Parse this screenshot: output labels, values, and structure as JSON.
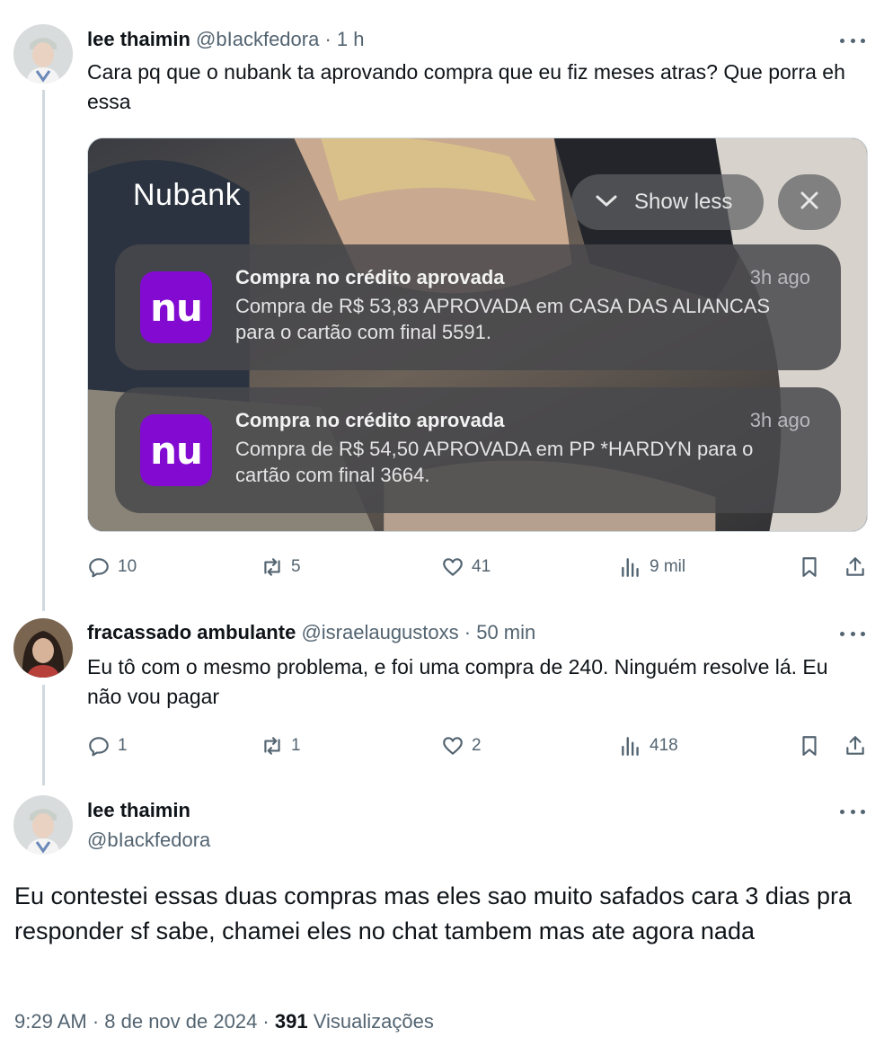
{
  "tweet1": {
    "name": "lee thaimin",
    "handle": "@bIackfedora",
    "dot": "·",
    "time": "1 h",
    "text": "Cara pq que o nubank ta aprovando compra que eu fiz meses atras? Que porra eh essa",
    "media": {
      "app_title": "Nubank",
      "show_less_label": "Show less",
      "notifications": [
        {
          "title": "Compra no crédito aprovada",
          "time": "3h ago",
          "logo_text": "nu",
          "body": "Compra de R$ 53,83 APROVADA em CASA DAS ALIANCAS para o cartão com final 5591."
        },
        {
          "title": "Compra no crédito aprovada",
          "time": "3h ago",
          "logo_text": "nu",
          "body": "Compra de R$ 54,50 APROVADA em PP *HARDYN para o cartão com final 3664."
        }
      ]
    },
    "actions": {
      "replies": "10",
      "reposts": "5",
      "likes": "41",
      "views": "9 mil"
    }
  },
  "tweet2": {
    "name": "fracassado ambulante",
    "handle": "@israelaugustoxs",
    "dot": "·",
    "time": "50 min",
    "text": "Eu tô com o mesmo problema, e foi uma compra de 240. Ninguém resolve lá. Eu não vou pagar",
    "actions": {
      "replies": "1",
      "reposts": "1",
      "likes": "2",
      "views": "418"
    }
  },
  "tweet3": {
    "name": "lee thaimin",
    "handle": "@bIackfedora",
    "text": "Eu contestei essas duas compras mas eles sao muito safados cara 3 dias pra responder sf sabe, chamei eles no chat tambem mas ate agora nada",
    "timestamp": "9:29 AM · 8 de nov de 2024 ·",
    "views_count": "391",
    "views_label": "Visualizações"
  },
  "colors": {
    "text_primary": "#0f1419",
    "text_secondary": "#536471",
    "thread_line": "#cfd9de",
    "nubank_purple": "#820ad1"
  },
  "icons": [
    "reply-icon",
    "repost-icon",
    "like-icon",
    "views-icon",
    "bookmark-icon",
    "share-icon",
    "more-icon",
    "chevron-down-icon",
    "close-icon"
  ]
}
